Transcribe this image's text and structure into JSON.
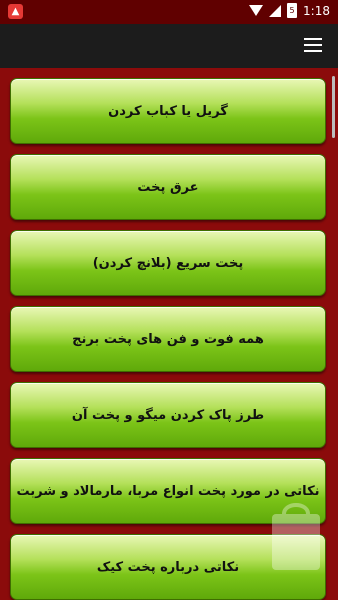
{
  "status_bar": {
    "time": "1:18",
    "battery_level_text": "5",
    "notification_icon": "app-notification-icon",
    "icons": [
      "wifi-icon",
      "cell-signal-icon",
      "battery-icon"
    ]
  },
  "app_bar": {
    "menu_icon": "hamburger-menu-icon"
  },
  "colors": {
    "background": "#8b0b0b",
    "app_bar": "#1c1c1c",
    "status_bar": "#600000",
    "button_green": "#7cc418"
  },
  "items": [
    {
      "label": "گریل یا کباب کردن"
    },
    {
      "label": "عرق پخت"
    },
    {
      "label": "پخت سریع (بلانچ کردن)"
    },
    {
      "label": "همه فوت و فن های پخت برنج"
    },
    {
      "label": "طرز پاک کردن میگو و پخت آن"
    },
    {
      "label": "نکاتی در مورد پخت انواع مربا، مارمالاد و شربت"
    },
    {
      "label": "نکاتی درباره پخت کیک"
    }
  ]
}
